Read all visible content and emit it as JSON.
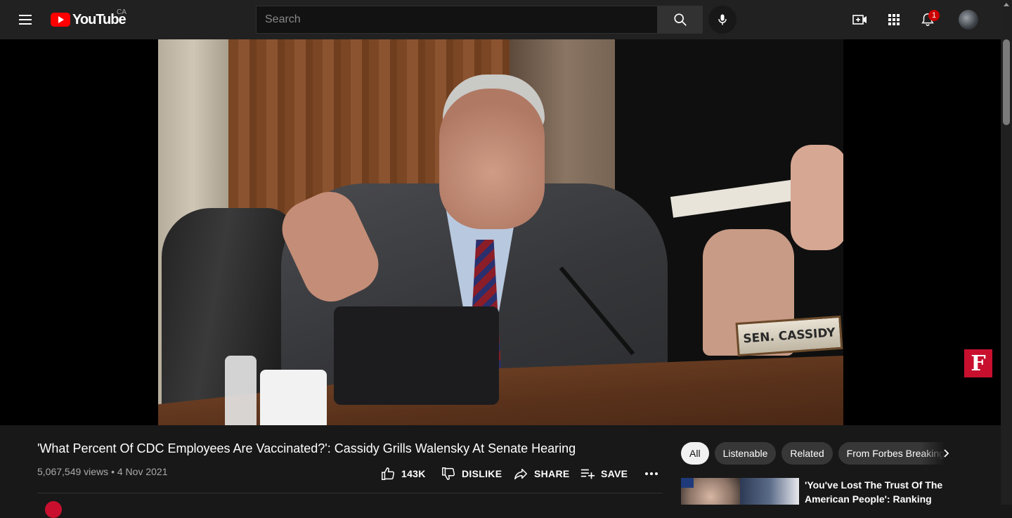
{
  "header": {
    "logo_text": "YouTube",
    "region": "CA",
    "search_placeholder": "Search",
    "notification_count": "1"
  },
  "video": {
    "nameplate": "SEN. CASSIDY",
    "watermark": "F",
    "title": "'What Percent Of CDC Employees Are Vaccinated?': Cassidy Grills Walensky At Senate Hearing",
    "views": "5,067,549 views",
    "date": "4 Nov 2021",
    "like_count": "143K",
    "dislike_label": "DISLIKE",
    "share_label": "SHARE",
    "save_label": "SAVE"
  },
  "sidebar": {
    "chips": [
      "All",
      "Listenable",
      "Related",
      "From Forbes Breaking News"
    ],
    "recommended": [
      {
        "title": "'You've Lost The Trust Of The American People': Ranking GO…"
      }
    ]
  },
  "colors": {
    "brand_red": "#ff0000",
    "forbes_red": "#c8102e",
    "background": "#181818",
    "topbar": "#212121"
  },
  "icons": [
    "menu-icon",
    "youtube-logo-icon",
    "search-icon",
    "mic-icon",
    "create-video-icon",
    "apps-grid-icon",
    "bell-icon",
    "thumb-up-icon",
    "thumb-down-icon",
    "share-icon",
    "playlist-add-icon",
    "more-icon",
    "chevron-right-icon"
  ]
}
